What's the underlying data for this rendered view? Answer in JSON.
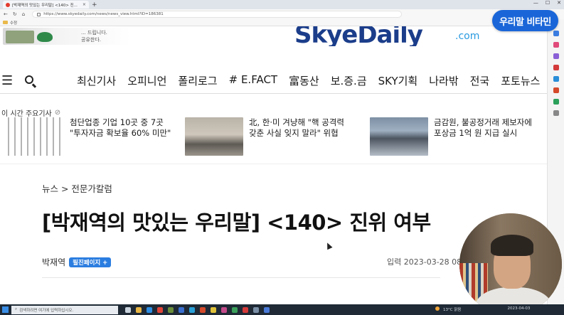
{
  "browser": {
    "tab_title": "[박재역의 맛있는 우리말] <140> 진...",
    "new_tab": "+",
    "window_controls": [
      "—",
      "☐",
      "✕"
    ],
    "url": "https://www.skyedaily.com/news/news_view.html?ID=186381",
    "favorites_folder": "수정"
  },
  "banner": {
    "ad_text_line1": "... 드립니다.",
    "ad_text_line2": "공유한다.",
    "logo": "SkyeDaily",
    "logo_suffix": ".com"
  },
  "overlay_badge": "우리말 비타민",
  "nav": {
    "items": [
      "최신기사",
      "오피니언",
      "폴리로그",
      "# E.FACT",
      "富동산",
      "보.증.금",
      "SKY기획",
      "나라밖",
      "전국",
      "포토뉴스"
    ]
  },
  "hot": {
    "label": "이 시간 주요기사",
    "items": [
      {
        "line1": "첨단업종 기업 10곳 중 7곳",
        "line2": "\"투자자금 확보율 60% 미만\""
      },
      {
        "line1": "北, 한·미 겨냥해 \"핵 공격력",
        "line2": "갖춘 사실 잊지 말라\" 위협"
      },
      {
        "line1": "금감원, 불공정거래 제보자에",
        "line2": "포상금 1억 원 지급 실시"
      }
    ]
  },
  "article": {
    "breadcrumb": "뉴스 > 전문가칼럼",
    "title": "[박재역의 맛있는 우리말] <140> 진위 여부",
    "author": "박재역",
    "author_tag": "필진페이지 +",
    "date": "입력 2023-03-28 08:"
  },
  "taskbar": {
    "search_placeholder": "검색하려면 여기에 입력하십시오.",
    "weather": "13°C 맑음",
    "date": "2023-04-03"
  },
  "colors": {
    "accent_blue": "#1a66d8",
    "logo_navy": "#1b3d8a",
    "pill_blue": "#2b7de0",
    "taskbar": "#1f2a36"
  }
}
